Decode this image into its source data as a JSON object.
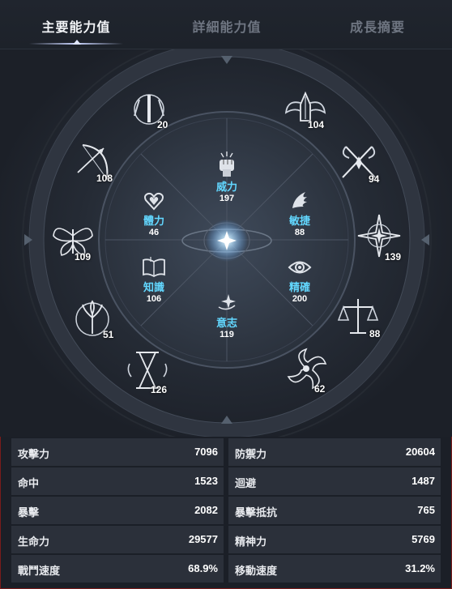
{
  "tabs": [
    {
      "label": "主要能力值",
      "active": true
    },
    {
      "label": "詳細能力值",
      "active": false
    },
    {
      "label": "成長摘要",
      "active": false
    }
  ],
  "inner_stats": [
    {
      "name": "威力",
      "value": "197",
      "icon": "fist-icon"
    },
    {
      "name": "敏捷",
      "value": "88",
      "icon": "wing-icon"
    },
    {
      "name": "精確",
      "value": "200",
      "icon": "eye-icon"
    },
    {
      "name": "意志",
      "value": "119",
      "icon": "spark-icon"
    },
    {
      "name": "知識",
      "value": "106",
      "icon": "book-icon"
    },
    {
      "name": "體力",
      "value": "46",
      "icon": "heart-icon"
    }
  ],
  "outer_stats": [
    {
      "value": "20",
      "icon": "sword-crest-icon"
    },
    {
      "value": "104",
      "icon": "winged-helm-icon"
    },
    {
      "value": "94",
      "icon": "crossed-scythes-icon"
    },
    {
      "value": "139",
      "icon": "compass-star-icon"
    },
    {
      "value": "88",
      "icon": "scales-icon"
    },
    {
      "value": "62",
      "icon": "flame-swirl-icon"
    },
    {
      "value": "126",
      "icon": "hourglass-icon"
    },
    {
      "value": "51",
      "icon": "tree-emblem-icon"
    },
    {
      "value": "109",
      "icon": "butterfly-icon"
    },
    {
      "value": "108",
      "icon": "bow-icon"
    }
  ],
  "combat_stats": [
    {
      "label": "攻擊力",
      "value": "7096"
    },
    {
      "label": "防禦力",
      "value": "20604"
    },
    {
      "label": "命中",
      "value": "1523"
    },
    {
      "label": "迴避",
      "value": "1487"
    },
    {
      "label": "暴擊",
      "value": "2082"
    },
    {
      "label": "暴擊抵抗",
      "value": "765"
    },
    {
      "label": "生命力",
      "value": "29577"
    },
    {
      "label": "精神力",
      "value": "5769"
    },
    {
      "label": "戰鬥速度",
      "value": "68.9%"
    },
    {
      "label": "移動速度",
      "value": "31.2%"
    }
  ],
  "colors": {
    "accent_text": "#62d7ff",
    "row_bg": "#2b303a",
    "active_tab": "#f1f3f6",
    "inactive_tab": "#6f7682"
  }
}
